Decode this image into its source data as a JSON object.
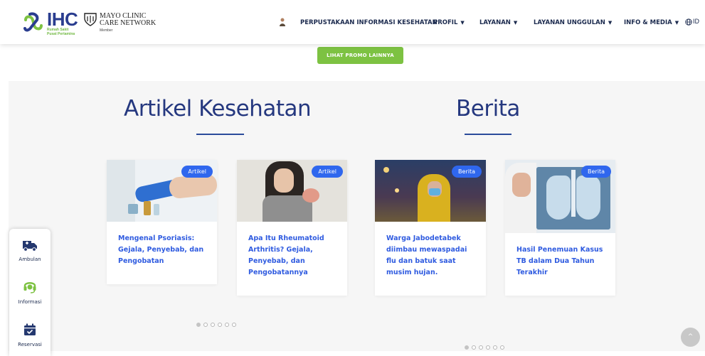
{
  "header": {
    "logo_text": "IHC",
    "logo_sub": "Rumah Sakit Pusat Pertamina",
    "mayo_line1": "MAYO CLINIC",
    "mayo_line2": "CARE NETWORK",
    "mayo_member": "Member",
    "nav": [
      {
        "label": "PERPUSTAKAAN INFORMASI KESEHATAN",
        "has_caret": false
      },
      {
        "label": "PROFIL",
        "has_caret": true
      },
      {
        "label": "LAYANAN",
        "has_caret": true
      },
      {
        "label": "LAYANAN UNGGULAN",
        "has_caret": true
      },
      {
        "label": "INFO & MEDIA",
        "has_caret": true
      }
    ],
    "language": "ID",
    "caret_glyph": "▼"
  },
  "promo": {
    "button_label": "LIHAT PROMO LAINNYA"
  },
  "artikel": {
    "title": "Artikel Kesehatan",
    "cards": [
      {
        "badge": "Artikel",
        "title": "Mengenal Psoriasis: Gejala, Penyebab, dan Pengobatan"
      },
      {
        "badge": "Artikel",
        "title": "Apa Itu Rheumatoid Arthritis? Gejala, Penyebab, dan Pengobatannya"
      }
    ],
    "dots": {
      "count": 6,
      "active": 0
    }
  },
  "berita": {
    "title": "Berita",
    "cards": [
      {
        "badge": "Berita",
        "title": "Warga Jabodetabek diimbau mewaspadai flu dan batuk saat musim hujan."
      },
      {
        "badge": "Berita",
        "title": "Hasil Penemuan Kasus TB dalam Dua Tahun Terakhir"
      }
    ],
    "dots": {
      "count": 6,
      "active": 0
    }
  },
  "side_panel": {
    "items": [
      {
        "label": "Ambulan",
        "icon": "ambulance-icon"
      },
      {
        "label": "Informasi",
        "icon": "headset-icon"
      },
      {
        "label": "Reservasi",
        "icon": "calendar-check-icon"
      }
    ]
  },
  "scroll_top": {
    "glyph": "^"
  },
  "colors": {
    "brand_blue": "#25387f",
    "brand_green": "#7dc242",
    "badge_blue": "#2f67ee",
    "link_blue": "#2f5be0"
  }
}
